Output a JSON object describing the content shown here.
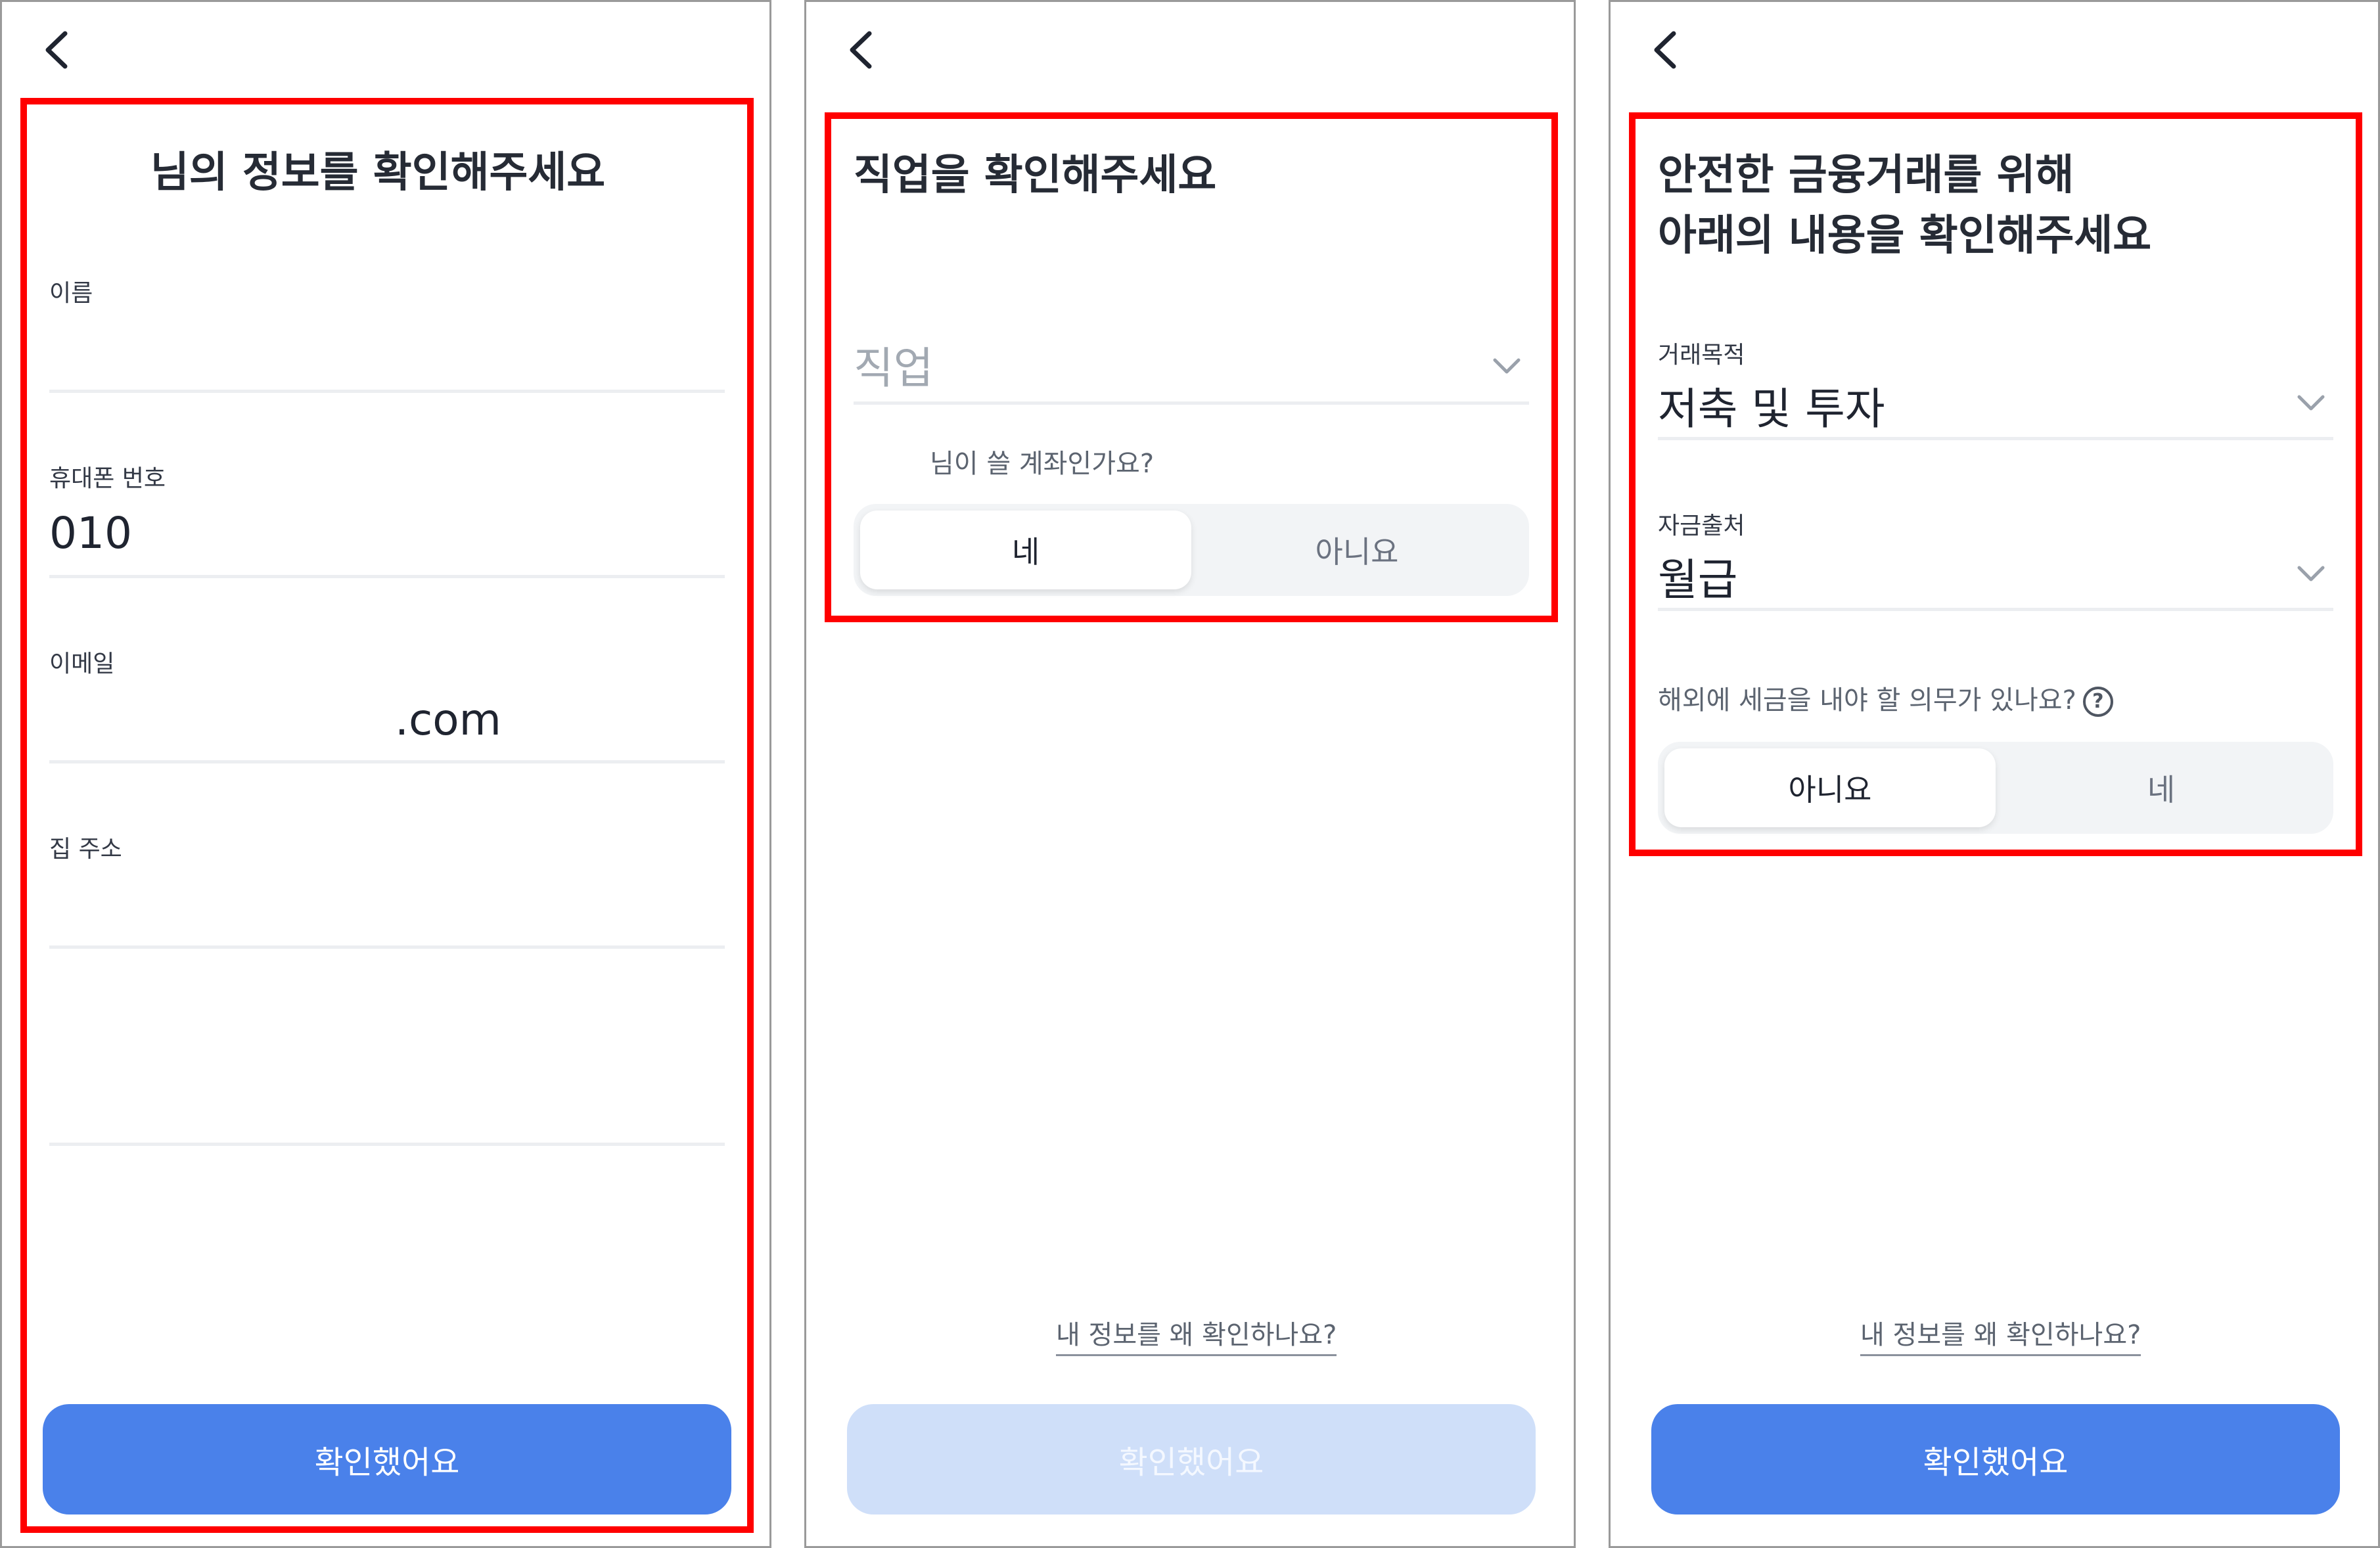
{
  "colors": {
    "primary": "#4a81ea",
    "primary_disabled": "#cfdff9",
    "highlight": "#ff0000",
    "segment_bg": "#f2f4f6"
  },
  "panel1": {
    "title": "님의 정보를 확인해주세요",
    "fields": [
      {
        "label": "이름",
        "value": ""
      },
      {
        "label": "휴대폰 번호",
        "value": "010"
      },
      {
        "label": "이메일",
        "value": ".com"
      },
      {
        "label": "집 주소",
        "value": ""
      }
    ],
    "confirm_button": "확인했어요"
  },
  "panel2": {
    "title": "직업을 확인해주세요",
    "job_placeholder": "직업",
    "question": "님이 쓸 계좌인가요?",
    "options": [
      "네",
      "아니요"
    ],
    "selected_option": "네",
    "why_link": "내 정보를 왜 확인하나요?",
    "confirm_button": "확인했어요"
  },
  "panel3": {
    "title_line1": "안전한 금융거래를 위해",
    "title_line2": "아래의 내용을 확인해주세요",
    "purpose_label": "거래목적",
    "purpose_value": "저축 및 투자",
    "source_label": "자금출처",
    "source_value": "월급",
    "tax_question": "해외에 세금을 내야 할 의무가 있나요?",
    "help_icon": "?",
    "options": [
      "아니요",
      "네"
    ],
    "selected_option": "아니요",
    "why_link": "내 정보를 왜 확인하나요?",
    "confirm_button": "확인했어요"
  }
}
